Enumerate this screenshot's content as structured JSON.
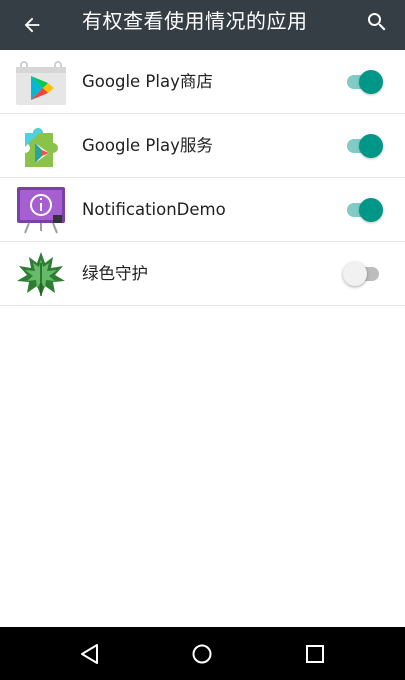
{
  "toolbar": {
    "title": "有权查看使用情况的应用",
    "back_icon": "arrow-back-icon",
    "search_icon": "search-icon",
    "background": "#353d45"
  },
  "apps": [
    {
      "name": "Google Play商店",
      "icon": "google-play-store-icon",
      "enabled": true
    },
    {
      "name": "Google Play服务",
      "icon": "google-play-services-icon",
      "enabled": true
    },
    {
      "name": "NotificationDemo",
      "icon": "notification-demo-icon",
      "enabled": true
    },
    {
      "name": "绿色守护",
      "icon": "greenify-icon",
      "enabled": false
    }
  ],
  "navbar": {
    "back_icon": "nav-back-icon",
    "home_icon": "nav-home-icon",
    "recents_icon": "nav-recents-icon"
  },
  "colors": {
    "accent": "#009688",
    "accent_track": "#80cbc4",
    "off_thumb": "#f1f1f1",
    "off_track": "#bdbdbd"
  }
}
